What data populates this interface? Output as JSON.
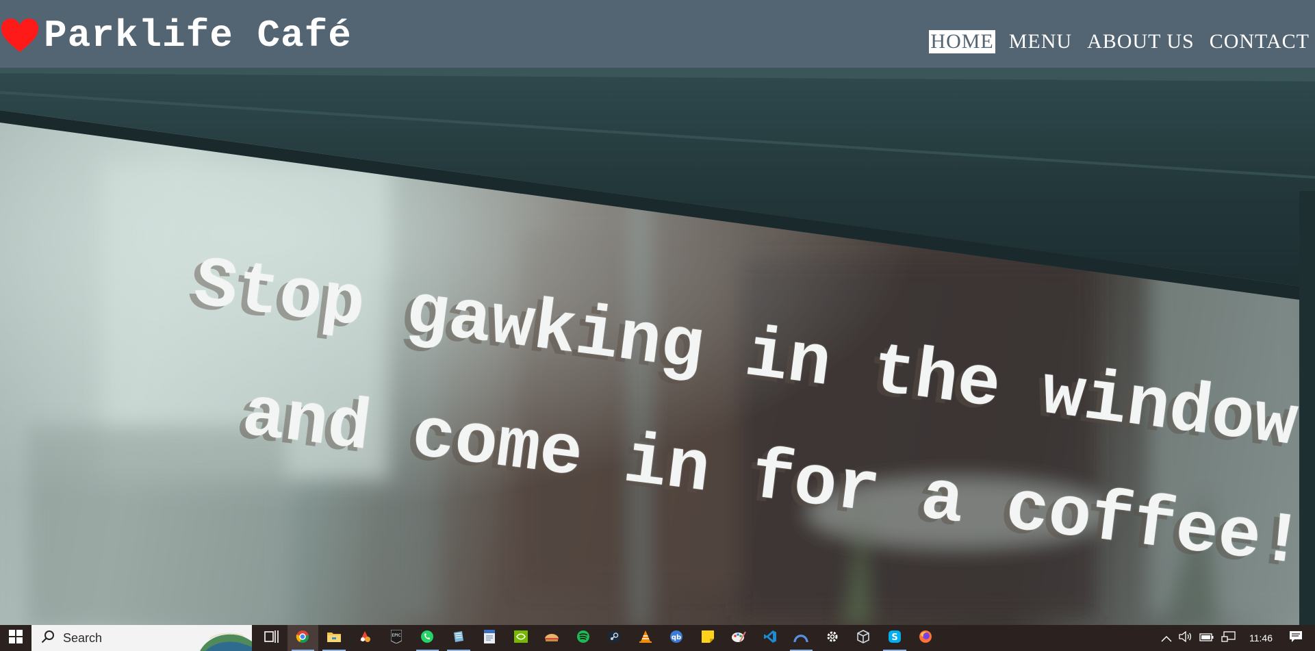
{
  "site": {
    "title": "Parklife Café",
    "nav": [
      {
        "label": "HOME",
        "active": true
      },
      {
        "label": "MENU",
        "active": false
      },
      {
        "label": "ABOUT US",
        "active": false
      },
      {
        "label": "CONTACT",
        "active": false
      }
    ]
  },
  "hero": {
    "line1": "Stop gawking in the window",
    "line2": "and come in for a coffee!"
  },
  "taskbar": {
    "search_placeholder": "Search",
    "apps": [
      "task-view-icon",
      "chrome-icon",
      "file-explorer-icon",
      "color-app-icon",
      "epic-games-icon",
      "whatsapp-icon",
      "notepad-icon",
      "document-icon",
      "nvidia-icon",
      "sandwich-app-icon",
      "spotify-icon",
      "steam-icon",
      "vlc-icon",
      "qbittorrent-icon",
      "sticky-notes-icon",
      "paint-icon",
      "vscode-icon",
      "arc-app-icon",
      "settings-icon",
      "box-app-icon",
      "skype-icon",
      "firefox-icon"
    ],
    "clock": "11:46"
  },
  "colors": {
    "header_bg": "#536472",
    "accent_heart": "#ff1a1a",
    "taskbar_bg": "#2b2220"
  }
}
